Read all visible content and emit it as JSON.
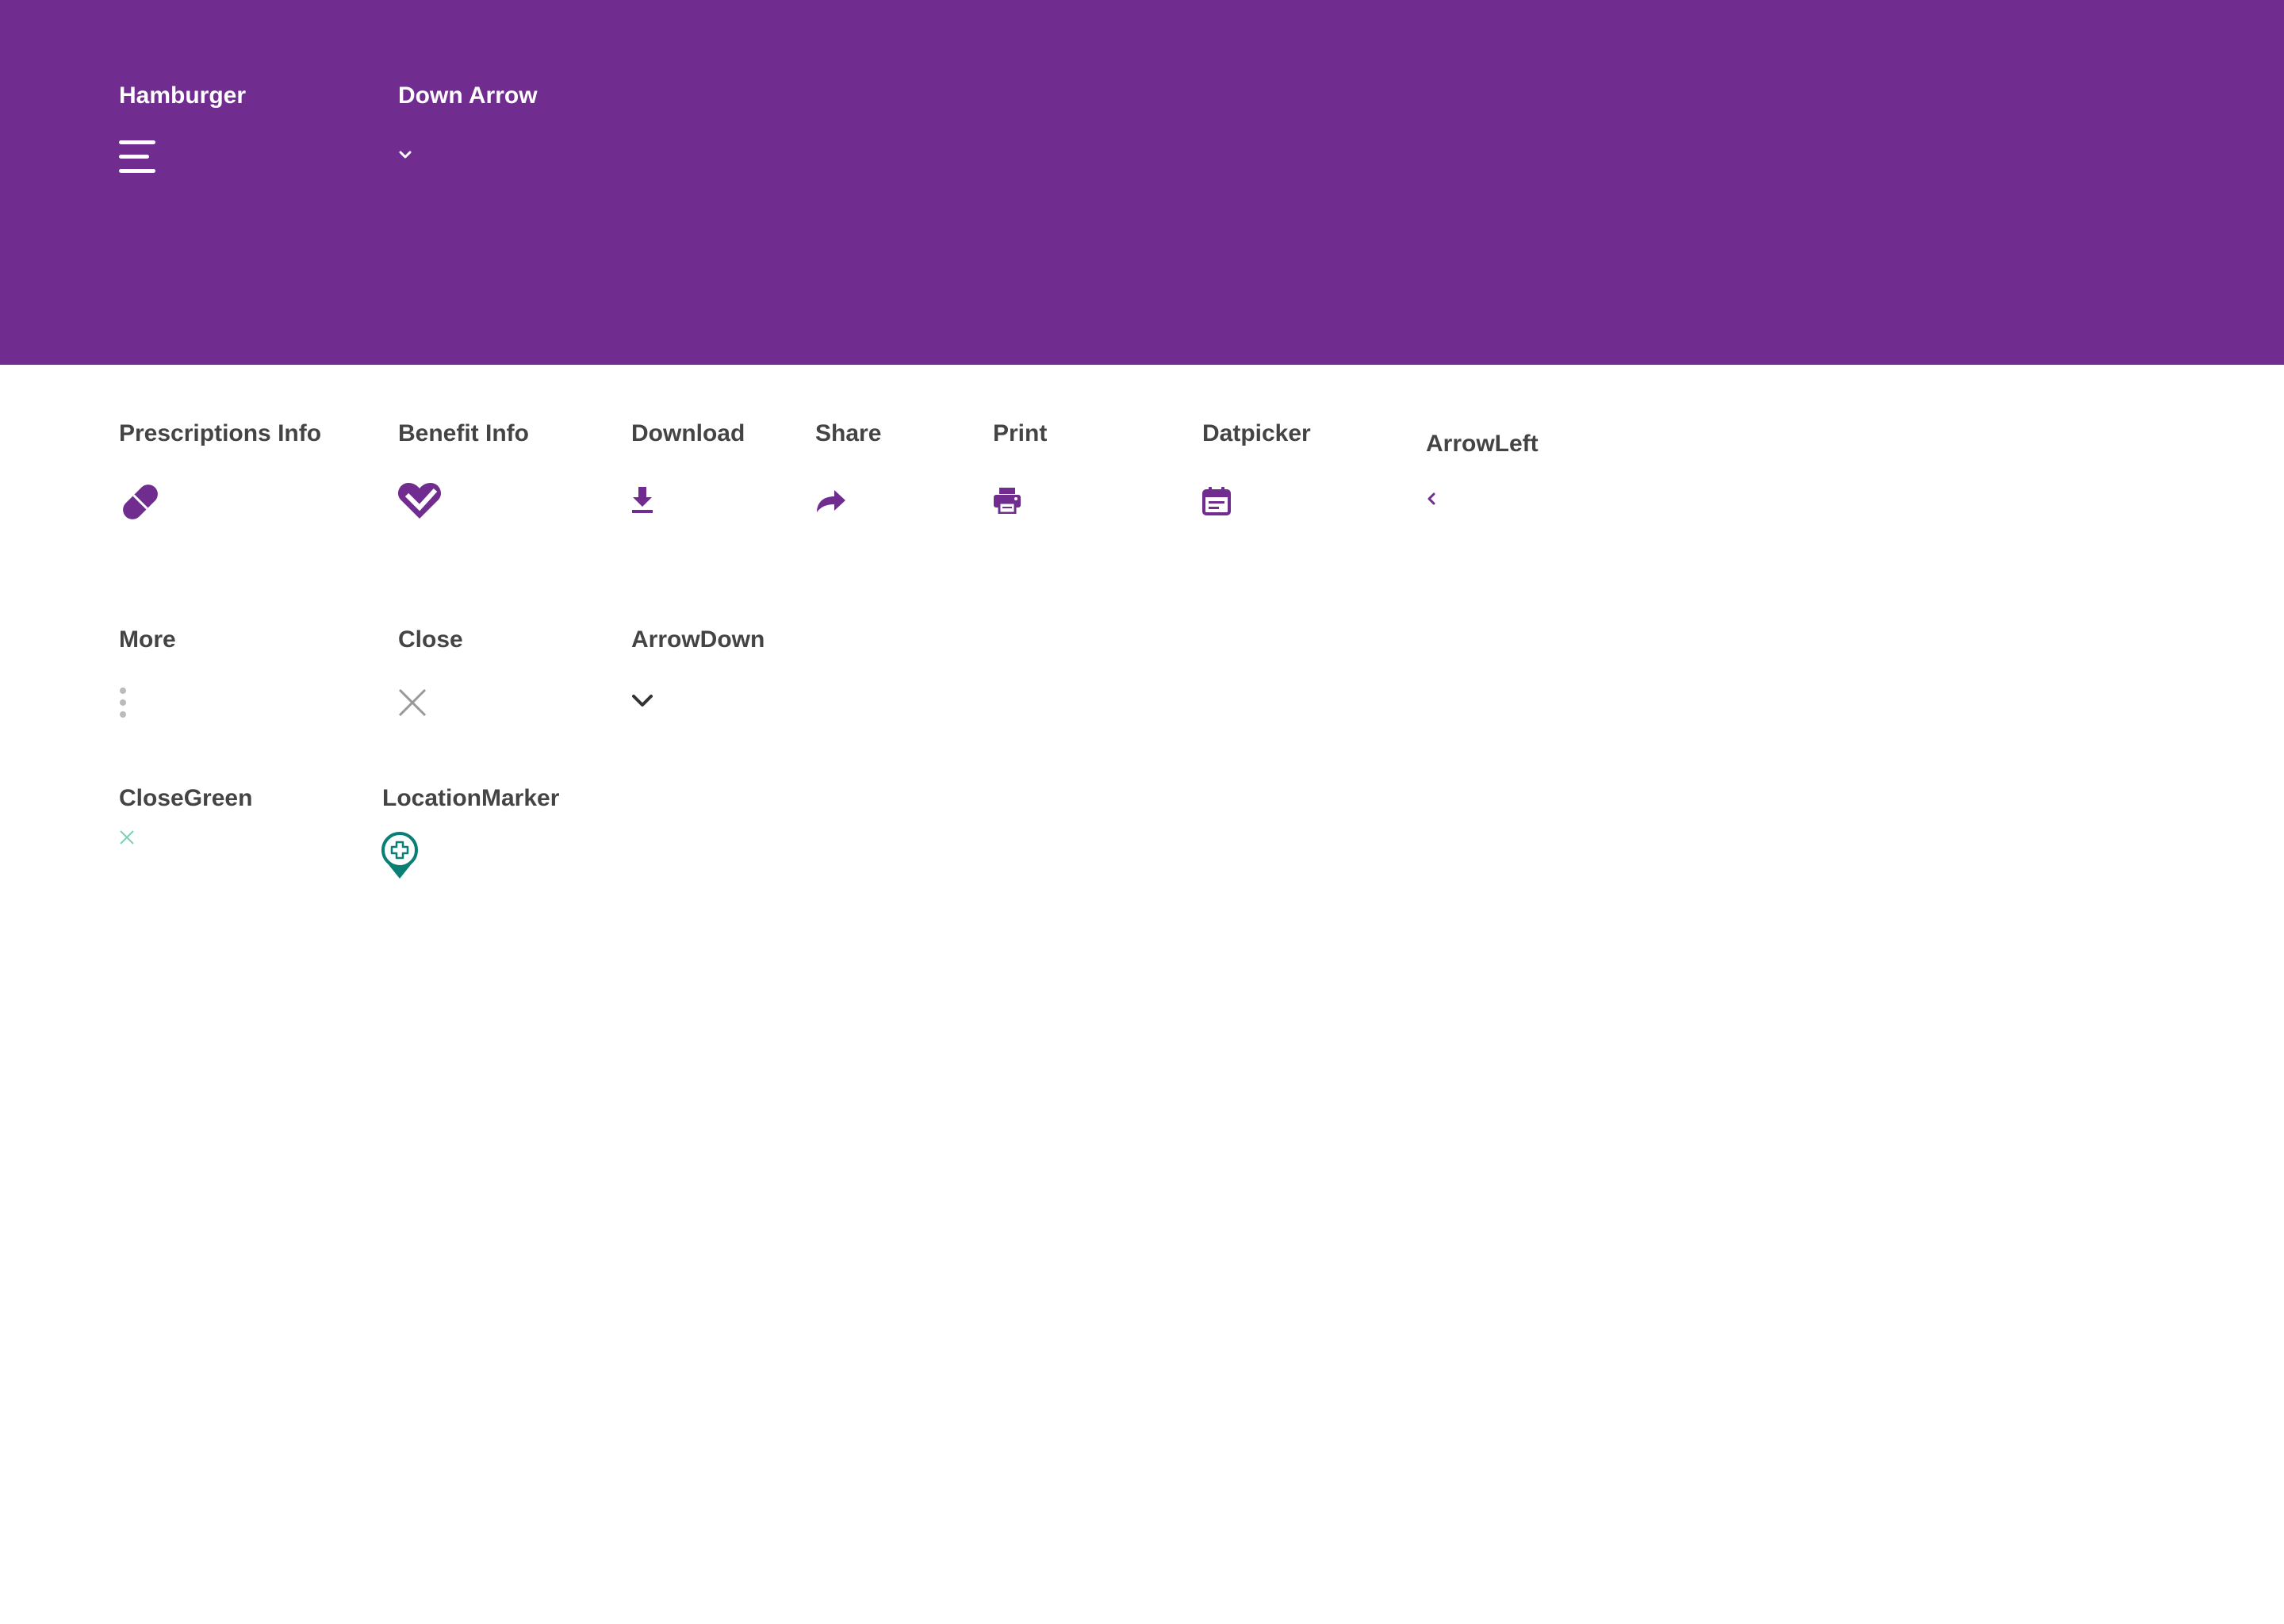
{
  "colors": {
    "banner_bg": "#702c8f",
    "icon_purple": "#702c8f",
    "label_text": "#444444",
    "icon_grey": "#999999",
    "icon_dark": "#333333",
    "icon_green_light": "#7fcfb8",
    "icon_teal": "#0a7f73"
  },
  "header_icons": [
    {
      "label": "Hamburger",
      "icon": "hamburger-icon"
    },
    {
      "label": "Down Arrow",
      "icon": "chevron-down-icon"
    }
  ],
  "row1_icons": [
    {
      "label": "Prescriptions Info",
      "icon": "pill-icon"
    },
    {
      "label": "Benefit Info",
      "icon": "heart-check-icon"
    },
    {
      "label": "Download",
      "icon": "download-icon"
    },
    {
      "label": "Share",
      "icon": "share-icon"
    },
    {
      "label": "Print",
      "icon": "printer-icon"
    },
    {
      "label": "Datpicker",
      "icon": "calendar-icon"
    },
    {
      "label": "ArrowLeft",
      "icon": "chevron-left-icon"
    }
  ],
  "row2_icons": [
    {
      "label": "More",
      "icon": "more-vertical-icon"
    },
    {
      "label": "Close",
      "icon": "close-icon"
    },
    {
      "label": "ArrowDown",
      "icon": "chevron-down-icon"
    }
  ],
  "row3_icons": [
    {
      "label": "CloseGreen",
      "icon": "close-icon"
    },
    {
      "label": "LocationMarker",
      "icon": "location-marker-icon"
    }
  ]
}
